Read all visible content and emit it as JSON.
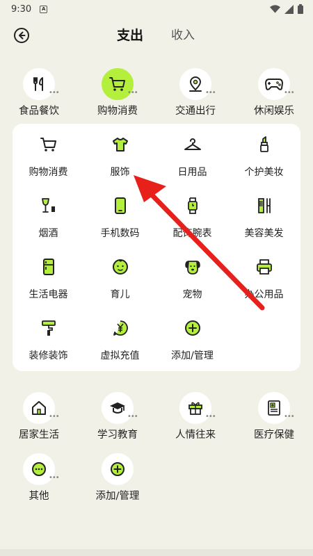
{
  "status_bar": {
    "time": "9:30",
    "notification_letter": "A"
  },
  "header": {
    "tab_expense": "支出",
    "tab_income": "收入"
  },
  "top_categories": [
    {
      "label": "食品餐饮",
      "icon": "utensils-icon"
    },
    {
      "label": "购物消费",
      "icon": "cart-icon",
      "active": true
    },
    {
      "label": "交通出行",
      "icon": "location-icon"
    },
    {
      "label": "休闲娱乐",
      "icon": "gamepad-icon"
    }
  ],
  "subcategories": [
    {
      "label": "购物消费",
      "icon": "cart-icon"
    },
    {
      "label": "服饰",
      "icon": "tshirt-icon"
    },
    {
      "label": "日用品",
      "icon": "hanger-icon"
    },
    {
      "label": "个护美妆",
      "icon": "lipstick-icon"
    },
    {
      "label": "烟酒",
      "icon": "wine-icon"
    },
    {
      "label": "手机数码",
      "icon": "phone-icon"
    },
    {
      "label": "配饰腕表",
      "icon": "watch-icon"
    },
    {
      "label": "美容美发",
      "icon": "comb-icon"
    },
    {
      "label": "生活电器",
      "icon": "fridge-icon"
    },
    {
      "label": "育儿",
      "icon": "baby-icon"
    },
    {
      "label": "宠物",
      "icon": "dog-icon"
    },
    {
      "label": "办公用品",
      "icon": "printer-icon"
    },
    {
      "label": "装修装饰",
      "icon": "paint-roller-icon"
    },
    {
      "label": "虚拟充值",
      "icon": "yen-coin-icon"
    },
    {
      "label": "添加/管理",
      "icon": "plus-circle-icon"
    }
  ],
  "bottom_categories": [
    {
      "label": "居家生活",
      "icon": "house-icon"
    },
    {
      "label": "学习教育",
      "icon": "graduation-cap-icon"
    },
    {
      "label": "人情往来",
      "icon": "gift-icon"
    },
    {
      "label": "医疗保健",
      "icon": "medical-record-icon"
    },
    {
      "label": "其他",
      "icon": "more-icon"
    },
    {
      "label": "添加/管理",
      "icon": "plus-circle-icon"
    }
  ],
  "colors": {
    "accent": "#b5ef3e",
    "background": "#f1f1e7",
    "arrow": "#e8201c"
  }
}
